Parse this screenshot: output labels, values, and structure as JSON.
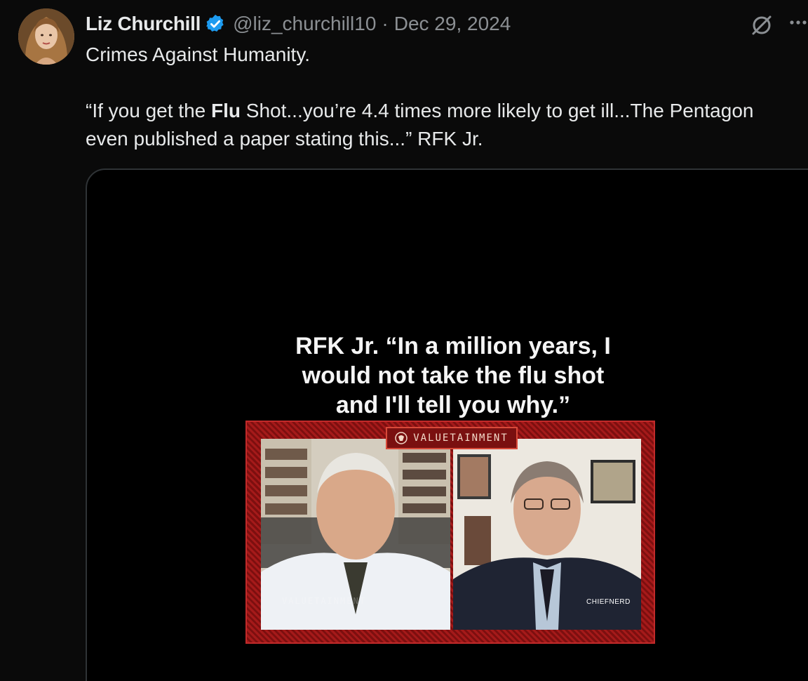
{
  "author": {
    "display_name": "Liz Churchill",
    "handle": "@liz_churchill10",
    "separator": "·",
    "date": "Dec 29, 2024",
    "verified": true
  },
  "icons": {
    "verified": "verified-badge-icon",
    "grok": "grok-icon",
    "more": "more-options-icon"
  },
  "colors": {
    "background": "#0a0a0a",
    "verified_blue": "#1d9bf0",
    "muted_text": "#8b8f93",
    "frame_red": "#a51a1a"
  },
  "post": {
    "line1": "Crimes Against Humanity.",
    "quote_part1": "“If you get the ",
    "quote_bold": "Flu",
    "quote_part2": " Shot...you’re 4.4 times more likely to get ill...The Pentagon",
    "line3": "even published a paper stating this...” RFK Jr."
  },
  "media": {
    "caption_line1": "RFK Jr. “In a million years, I",
    "caption_line2": "would not take the flu shot",
    "caption_line3": "and I'll tell you why.”",
    "brand": "VALUETAINMENT",
    "watermark_left": "VALUETAINMENT",
    "watermark_right": "CHIEFNERD"
  }
}
